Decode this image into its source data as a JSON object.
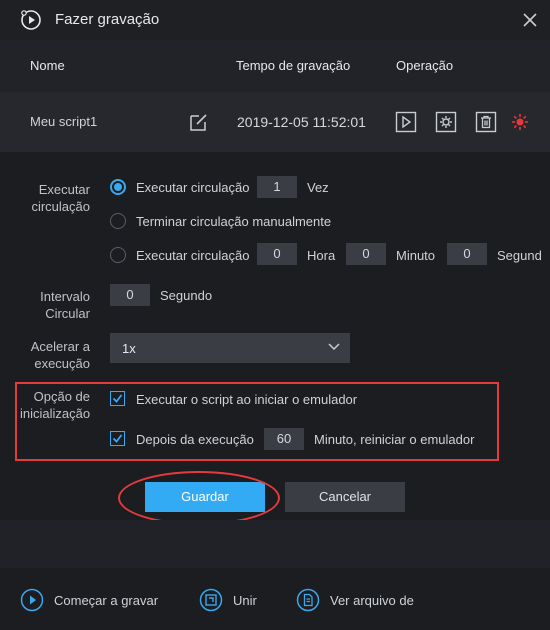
{
  "window": {
    "title": "Fazer gravação"
  },
  "columns": {
    "name": "Nome",
    "time": "Tempo de gravação",
    "operation": "Operação"
  },
  "script": {
    "name": "Meu script1",
    "date": "2019-12-05 11:52:01"
  },
  "loop": {
    "label": "Executar circulação",
    "option1": {
      "text": "Executar circulação",
      "value": "1",
      "unit": "Vez"
    },
    "option2": {
      "text": "Terminar circulação manualmente"
    },
    "option3": {
      "text": "Executar circulação",
      "hours": "0",
      "hours_unit": "Hora",
      "minutes": "0",
      "minutes_unit": "Minuto",
      "seconds": "0",
      "seconds_unit": "Segund"
    }
  },
  "interval": {
    "label": "Intervalo Circular",
    "value": "0",
    "unit": "Segundo"
  },
  "speed": {
    "label": "Acelerar a execução",
    "value": "1x"
  },
  "startup": {
    "label": "Opção de inicialização",
    "option1": "Executar o script ao iniciar o emulador",
    "option2_prefix": "Depois da execução",
    "option2_value": "60",
    "option2_suffix": "Minuto, reiniciar o emulador"
  },
  "buttons": {
    "save": "Guardar",
    "cancel": "Cancelar"
  },
  "footer": {
    "record": "Começar a gravar",
    "merge": "Unir",
    "view": "Ver arquivo de"
  },
  "colors": {
    "accent": "#33aaf4",
    "highlight": "#e43b3b",
    "background": "#1b1d21"
  }
}
